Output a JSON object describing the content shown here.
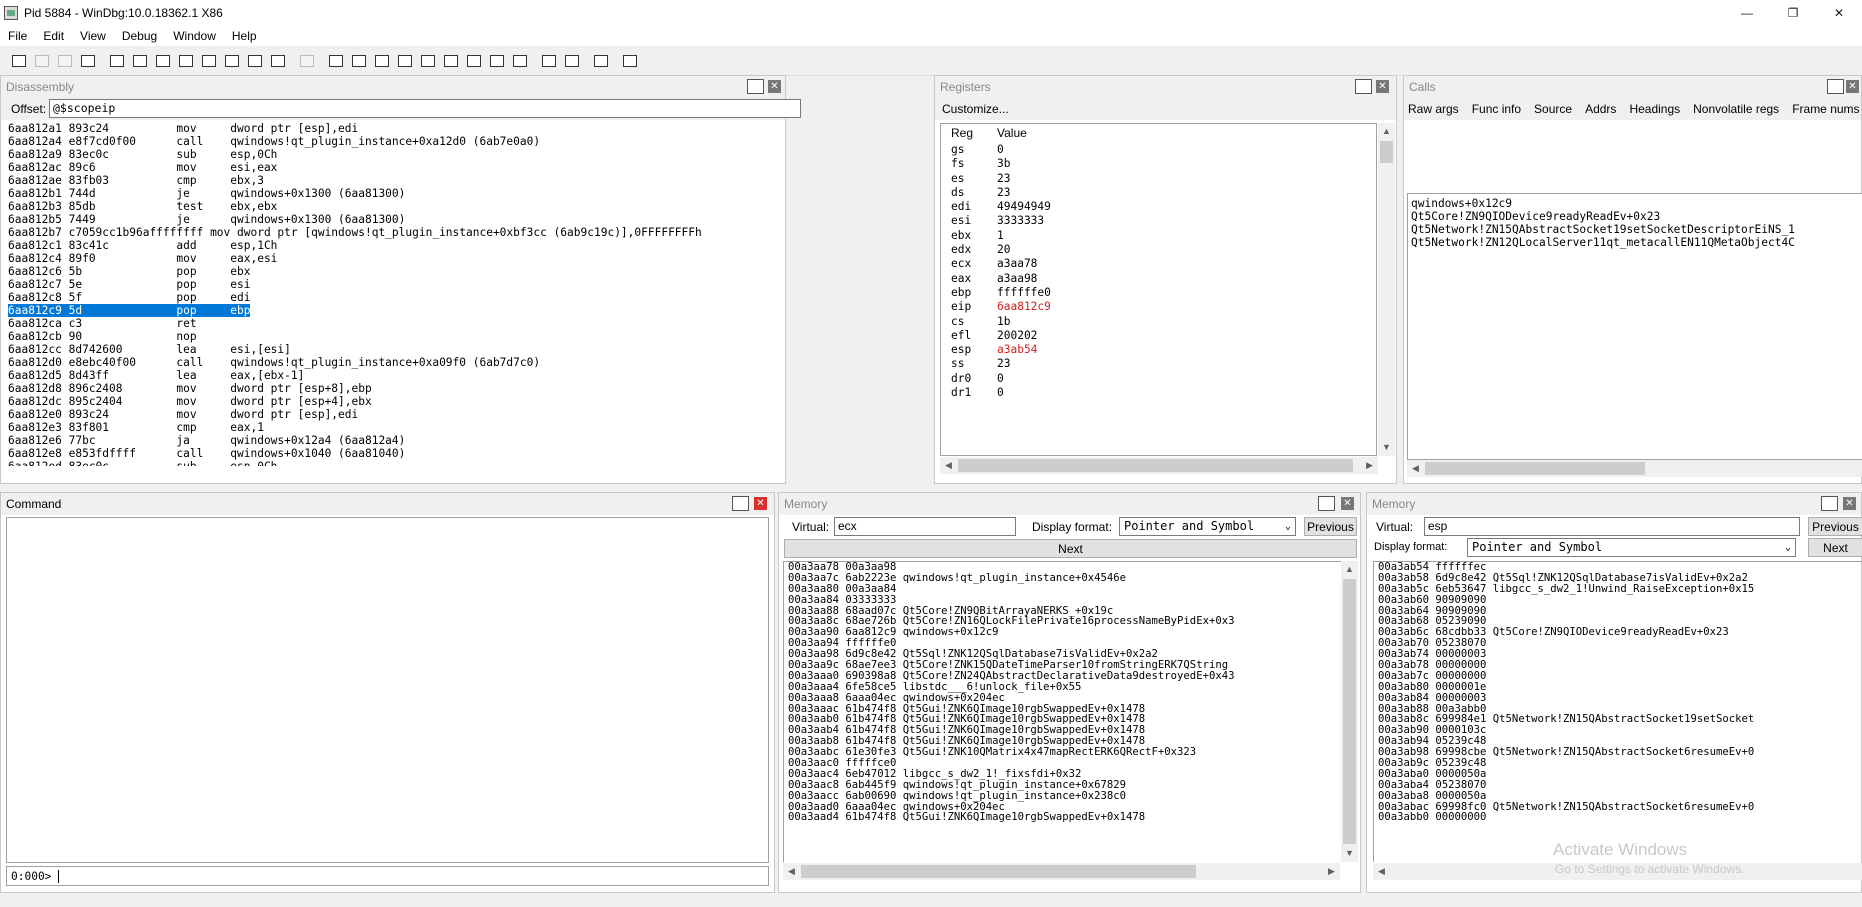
{
  "window": {
    "title": "Pid 5884 - WinDbg:10.0.18362.1 X86",
    "buttons": [
      "—",
      "❐",
      "✕"
    ]
  },
  "menu": [
    "File",
    "Edit",
    "View",
    "Debug",
    "Window",
    "Help"
  ],
  "toolbar": {
    "icons": [
      "open-icon",
      "cut-icon",
      "copy-icon",
      "paste-icon",
      "go-icon",
      "restart-icon",
      "stop-icon",
      "break-icon",
      "step-into-icon",
      "step-over-icon",
      "step-out-icon",
      "run-to-cursor-icon",
      "hand-icon",
      "command-window-icon",
      "watch-icon",
      "locals-icon",
      "registers-icon",
      "memory-icon",
      "call-stack-icon",
      "disassembly-icon",
      "scratch-pad-icon",
      "processes-icon",
      "source-mode-icon",
      "hex-icon",
      "font-icon",
      "options-icon"
    ]
  },
  "disassembly": {
    "title": "Disassembly",
    "offset_label": "Offset:",
    "offset_value": "@$scopeip",
    "previous": "Previous",
    "next": "Next",
    "lines": [
      "6aa812a1 893c24          mov     dword ptr [esp],edi",
      "6aa812a4 e8f7cd0f00      call    qwindows!qt_plugin_instance+0xa12d0 (6ab7e0a0)",
      "6aa812a9 83ec0c          sub     esp,0Ch",
      "6aa812ac 89c6            mov     esi,eax",
      "6aa812ae 83fb03          cmp     ebx,3",
      "6aa812b1 744d            je      qwindows+0x1300 (6aa81300)",
      "6aa812b3 85db            test    ebx,ebx",
      "6aa812b5 7449            je      qwindows+0x1300 (6aa81300)",
      "6aa812b7 c7059cc1b96affffffff mov dword ptr [qwindows!qt_plugin_instance+0xbf3cc (6ab9c19c)],0FFFFFFFFh",
      "6aa812c1 83c41c          add     esp,1Ch",
      "6aa812c4 89f0            mov     eax,esi",
      "6aa812c6 5b              pop     ebx",
      "6aa812c7 5e              pop     esi",
      "6aa812c8 5f              pop     edi",
      "6aa812c9 5d              pop     ebp",
      "6aa812ca c3              ret",
      "6aa812cb 90              nop",
      "6aa812cc 8d742600        lea     esi,[esi]",
      "6aa812d0 e8ebc40f00      call    qwindows!qt_plugin_instance+0xa09f0 (6ab7d7c0)",
      "6aa812d5 8d43ff          lea     eax,[ebx-1]",
      "6aa812d8 896c2408        mov     dword ptr [esp+8],ebp",
      "6aa812dc 895c2404        mov     dword ptr [esp+4],ebx",
      "6aa812e0 893c24          mov     dword ptr [esp],edi",
      "6aa812e3 83f801          cmp     eax,1",
      "6aa812e6 77bc            ja      qwindows+0x12a4 (6aa812a4)",
      "6aa812e8 e853fdffff      call    qwindows+0x1040 (6aa81040)",
      "6aa812ed 83ec0c          sub     esp,0Ch",
      "6aa812f0 85c0            test    eax,eax"
    ],
    "highlight_index": 14
  },
  "registers": {
    "title": "Registers",
    "customize": "Customize...",
    "col_reg": "Reg",
    "col_value": "Value",
    "rows": [
      {
        "reg": "gs",
        "value": "0",
        "changed": false
      },
      {
        "reg": "fs",
        "value": "3b",
        "changed": false
      },
      {
        "reg": "es",
        "value": "23",
        "changed": false
      },
      {
        "reg": "ds",
        "value": "23",
        "changed": false
      },
      {
        "reg": "edi",
        "value": "49494949",
        "changed": false
      },
      {
        "reg": "esi",
        "value": "3333333",
        "changed": false
      },
      {
        "reg": "ebx",
        "value": "1",
        "changed": false
      },
      {
        "reg": "edx",
        "value": "20",
        "changed": false
      },
      {
        "reg": "ecx",
        "value": "a3aa78",
        "changed": false
      },
      {
        "reg": "eax",
        "value": "a3aa98",
        "changed": false
      },
      {
        "reg": "ebp",
        "value": "ffffffe0",
        "changed": false
      },
      {
        "reg": "eip",
        "value": "6aa812c9",
        "changed": true
      },
      {
        "reg": "cs",
        "value": "1b",
        "changed": false
      },
      {
        "reg": "efl",
        "value": "200202",
        "changed": false
      },
      {
        "reg": "esp",
        "value": "a3ab54",
        "changed": true
      },
      {
        "reg": "ss",
        "value": "23",
        "changed": false
      },
      {
        "reg": "dr0",
        "value": "0",
        "changed": false
      },
      {
        "reg": "dr1",
        "value": "0",
        "changed": false
      }
    ]
  },
  "calls": {
    "title": "Calls",
    "options": [
      "Raw args",
      "Func info",
      "Source",
      "Addrs",
      "Headings",
      "Nonvolatile regs",
      "Frame nums",
      "Sc"
    ],
    "frames": [
      "qwindows+0x12c9",
      "Qt5Core!ZN9QIODevice9readyReadEv+0x23",
      "Qt5Network!ZN15QAbstractSocket19setSocketDescriptorEiNS_1",
      "Qt5Network!ZN12QLocalServer11qt_metacallEN11QMetaObject4C"
    ]
  },
  "command": {
    "title": "Command",
    "prompt": "0:000>",
    "input": ""
  },
  "memory1": {
    "title": "Memory",
    "virtual_label": "Virtual:",
    "virtual_value": "ecx",
    "display_label": "Display format:",
    "display_value": "Pointer and Symbol",
    "previous": "Previous",
    "next": "Next",
    "lines": [
      "00a3aa78 00a3aa98",
      "00a3aa7c 6ab2223e qwindows!qt_plugin_instance+0x4546e",
      "00a3aa80 00a3aa84",
      "00a3aa84 03333333",
      "00a3aa88 68aad07c Qt5Core!ZN9QBitArrayaNERKS_+0x19c",
      "00a3aa8c 68ae726b Qt5Core!ZN16QLockFilePrivate16processNameByPidEx+0x3",
      "00a3aa90 6aa812c9 qwindows+0x12c9",
      "00a3aa94 ffffffe0",
      "00a3aa98 6d9c8e42 Qt5Sql!ZNK12QSqlDatabase7isValidEv+0x2a2",
      "00a3aa9c 68ae7ee3 Qt5Core!ZNK15QDateTimeParser10fromStringERK7QString",
      "00a3aaa0 690398a8 Qt5Core!ZN24QAbstractDeclarativeData9destroyedE+0x43",
      "00a3aaa4 6fe58ce5 libstdc___6!unlock_file+0x55",
      "00a3aaa8 6aaa04ec qwindows+0x204ec",
      "00a3aaac 61b474f8 Qt5Gui!ZNK6QImage10rgbSwappedEv+0x1478",
      "00a3aab0 61b474f8 Qt5Gui!ZNK6QImage10rgbSwappedEv+0x1478",
      "00a3aab4 61b474f8 Qt5Gui!ZNK6QImage10rgbSwappedEv+0x1478",
      "00a3aab8 61b474f8 Qt5Gui!ZNK6QImage10rgbSwappedEv+0x1478",
      "00a3aabc 61e30fe3 Qt5Gui!ZNK10QMatrix4x47mapRectERK6QRectF+0x323",
      "00a3aac0 fffffce0",
      "00a3aac4 6eb47012 libgcc_s_dw2_1!_fixsfdi+0x32",
      "00a3aac8 6ab445f9 qwindows!qt_plugin_instance+0x67829",
      "00a3aacc 6ab00690 qwindows!qt_plugin_instance+0x238c0",
      "00a3aad0 6aaa04ec qwindows+0x204ec",
      "00a3aad4 61b474f8 Qt5Gui!ZNK6QImage10rgbSwappedEv+0x1478"
    ]
  },
  "memory2": {
    "title": "Memory",
    "virtual_label": "Virtual:",
    "virtual_value": "esp",
    "display_label": "Display format:",
    "display_value": "Pointer and Symbol",
    "previous": "Previous",
    "next": "Next",
    "lines": [
      "00a3ab54 ffffffec",
      "00a3ab58 6d9c8e42 Qt5Sql!ZNK12QSqlDatabase7isValidEv+0x2a2",
      "00a3ab5c 6eb53647 libgcc_s_dw2_1!Unwind_RaiseException+0x15",
      "00a3ab60 90909090",
      "00a3ab64 90909090",
      "00a3ab68 05239090",
      "00a3ab6c 68cdbb33 Qt5Core!ZN9QIODevice9readyReadEv+0x23",
      "00a3ab70 05238070",
      "00a3ab74 00000003",
      "00a3ab78 00000000",
      "00a3ab7c 00000000",
      "00a3ab80 0000001e",
      "00a3ab84 00000003",
      "00a3ab88 00a3abb0",
      "00a3ab8c 699984e1 Qt5Network!ZN15QAbstractSocket19setSocket",
      "00a3ab90 0000103c",
      "00a3ab94 05239c48",
      "00a3ab98 69998cbe Qt5Network!ZN15QAbstractSocket6resumeEv+0",
      "00a3ab9c 05239c48",
      "00a3aba0 0000050a",
      "00a3aba4 05238070",
      "00a3aba8 0000050a",
      "00a3abac 69998fc0 Qt5Network!ZN15QAbstractSocket6resumeEv+0",
      "00a3abb0 00000000"
    ]
  },
  "watermark": {
    "line1": "Activate Windows",
    "line2": "Go to Settings to activate Windows."
  },
  "colors": {
    "selection": "#0078d7",
    "changed_register": "#d02020",
    "close_red": "#d9302b"
  }
}
